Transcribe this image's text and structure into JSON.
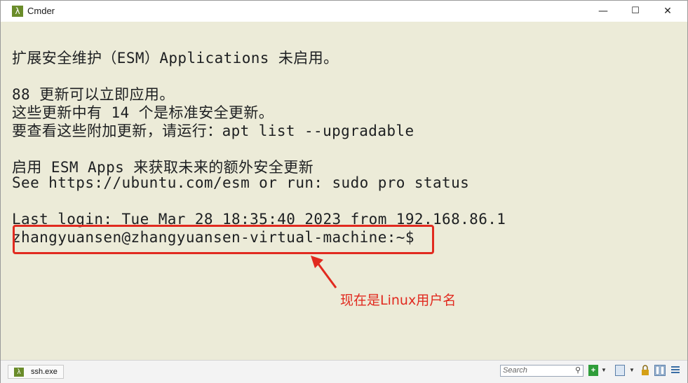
{
  "window": {
    "title": "Cmder",
    "app_icon_glyph": "λ",
    "controls": {
      "minimize": "—",
      "maximize": "☐",
      "close": "✕"
    }
  },
  "terminal": {
    "lines": [
      "扩展安全维护（ESM）Applications 未启用。",
      "",
      "88 更新可以立即应用。",
      "这些更新中有 14 个是标准安全更新。",
      "要查看这些附加更新，请运行：apt list --upgradable",
      "",
      "启用 ESM Apps 来获取未来的额外安全更新",
      "See https://ubuntu.com/esm or run: sudo pro status",
      "",
      "Last login: Tue Mar 28 18:35:40 2023 from 192.168.86.1",
      "zhangyuansen@zhangyuansen-virtual-machine:~$"
    ],
    "annotation": "现在是Linux用户名",
    "annotation_color": "#e12a1f",
    "background_color": "#ecebd8"
  },
  "statusbar": {
    "tab_label": "ssh.exe",
    "tab_icon_glyph": "λ",
    "search_placeholder": "Search",
    "icons": [
      "search-icon",
      "add-console-icon",
      "dropdown-icon",
      "console-icon",
      "lock-icon",
      "split-view-icon",
      "menu-icon"
    ]
  }
}
